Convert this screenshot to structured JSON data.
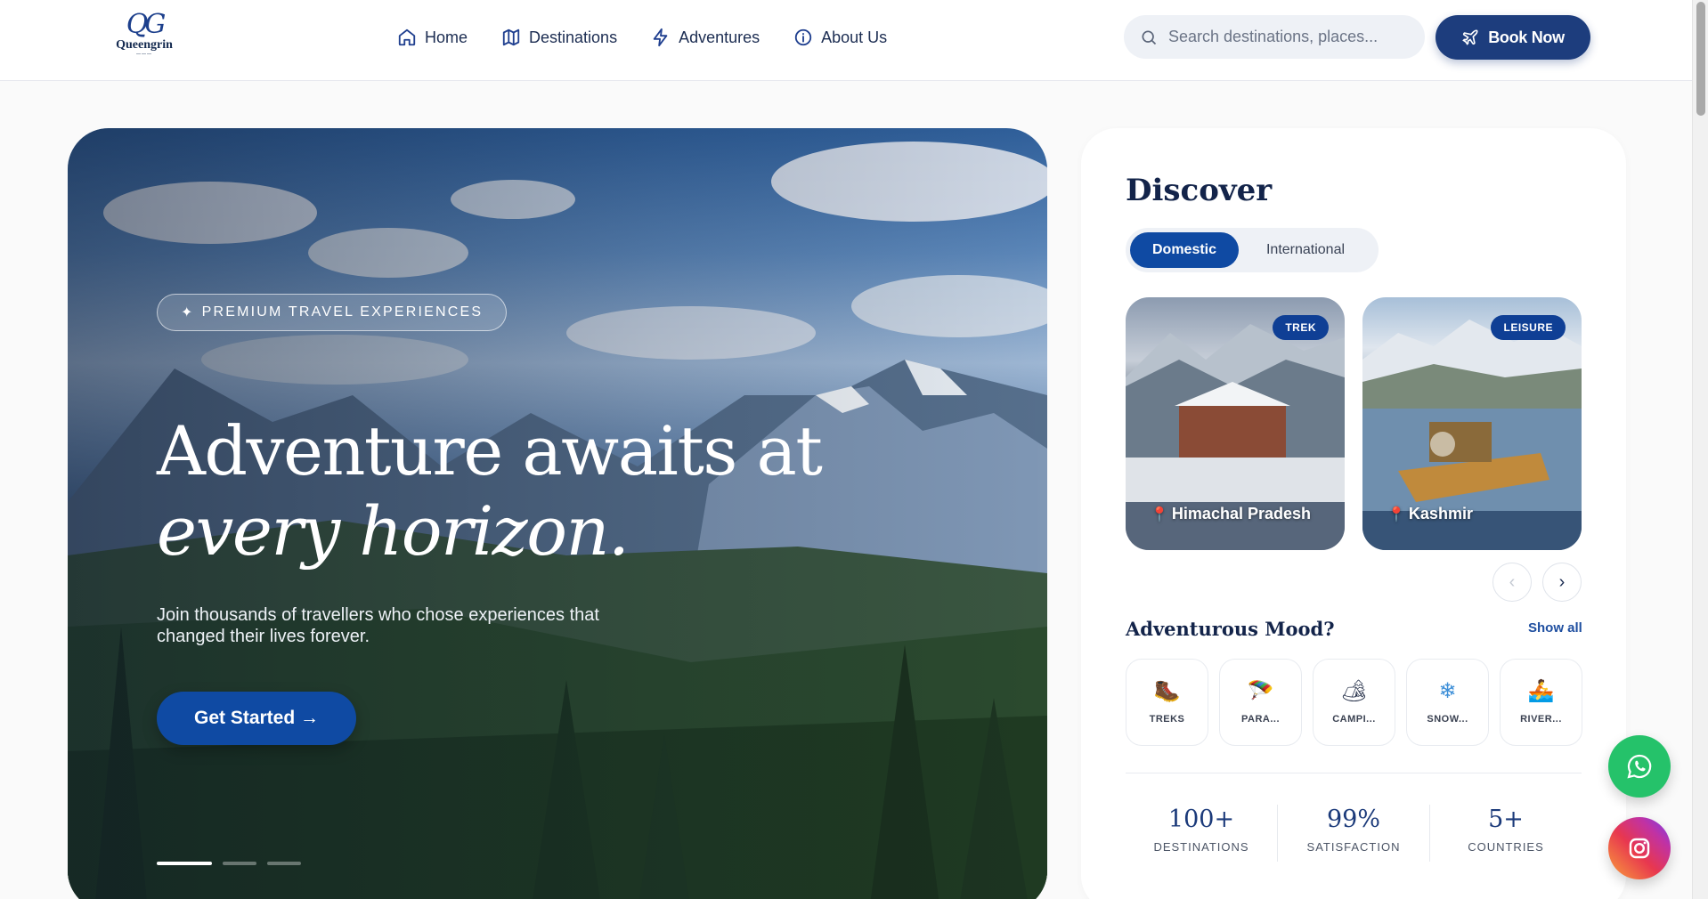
{
  "brand": {
    "mark": "QG",
    "name": "Queengrin"
  },
  "nav": [
    {
      "label": "Home",
      "icon": "home-icon"
    },
    {
      "label": "Destinations",
      "icon": "map-icon"
    },
    {
      "label": "Adventures",
      "icon": "lightning-icon"
    },
    {
      "label": "About Us",
      "icon": "info-icon"
    }
  ],
  "search": {
    "placeholder": "Search destinations, places..."
  },
  "book": {
    "label": "Book Now"
  },
  "hero": {
    "badge": "PREMIUM TRAVEL EXPERIENCES",
    "title_line1": "Adventure awaits at",
    "title_line2": "every horizon.",
    "subtitle": "Join thousands of travellers who chose experiences that changed their lives forever.",
    "cta": "Get Started →",
    "slides": 3,
    "active_slide": 1
  },
  "discover": {
    "title": "Discover",
    "tabs": [
      {
        "label": "Domestic",
        "active": true
      },
      {
        "label": "International",
        "active": false
      }
    ],
    "cards": [
      {
        "tag": "TREK",
        "place": "Himachal Pradesh"
      },
      {
        "tag": "LEISURE",
        "place": "Kashmir"
      }
    ],
    "prev": "‹",
    "next": "›"
  },
  "mood": {
    "title": "Adventurous Mood?",
    "show_all": "Show all",
    "items": [
      {
        "label": "TREKS",
        "icon": "boot-icon",
        "glyph": "🥾"
      },
      {
        "label": "PARA...",
        "icon": "parachute-icon",
        "glyph": "🪂"
      },
      {
        "label": "CAMPI...",
        "icon": "camping-icon",
        "glyph": "🏕"
      },
      {
        "label": "SNOW...",
        "icon": "snowflake-icon",
        "glyph": "❄"
      },
      {
        "label": "RIVER...",
        "icon": "rafting-icon",
        "glyph": "🚣"
      }
    ]
  },
  "stats": [
    {
      "value": "100+",
      "label": "DESTINATIONS"
    },
    {
      "value": "99%",
      "label": "SATISFACTION"
    },
    {
      "value": "5+",
      "label": "COUNTRIES"
    }
  ],
  "colors": {
    "primary": "#1d3d7d",
    "accent": "#0f4aa3",
    "whatsapp": "#25c26a"
  }
}
